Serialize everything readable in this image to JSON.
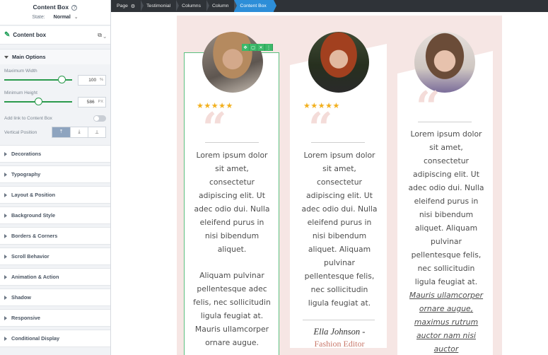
{
  "sidebar": {
    "title": "Content Box",
    "help_icon": "?",
    "state_label": "State:",
    "state_value": "Normal",
    "block_label": "Content box",
    "main_options": {
      "header": "Main Options",
      "max_width_label": "Maximum Width",
      "max_width_value": "100",
      "max_width_unit": "%",
      "max_width_slider": 0.85,
      "min_height_label": "Minimum Height",
      "min_height_value": "586",
      "min_height_unit": "PX",
      "min_height_slider": 0.5,
      "link_label": "Add link to Content Box",
      "vpos_label": "Vertical Position",
      "vpos_options": [
        "⤒",
        "⤓",
        "⊥"
      ]
    },
    "sections": [
      "Decorations",
      "Typography",
      "Layout & Position",
      "Background Style",
      "Borders & Corners",
      "Scroll Behavior",
      "Animation & Action",
      "Shadow",
      "Responsive",
      "Conditional Display"
    ]
  },
  "breadcrumb": [
    "Page",
    "Testimonial",
    "Columns",
    "Column",
    "Content Box"
  ],
  "canvas": {
    "toolbar": [
      "✥",
      "▢",
      "🗑",
      "⋮"
    ],
    "cards": [
      {
        "stars": "★★★★★",
        "quote": "“",
        "text": "Lorem ipsum dolor sit amet, consectetur adipiscing elit. Ut adec odio dui. Nulla eleifend purus in nisi bibendum aliquet.",
        "text2": "Aliquam pulvinar pellentesque adec felis, nec sollicitudin ligula feugiat at. Mauris ullamcorper ornare augue."
      },
      {
        "stars": "★★★★★",
        "quote": "“",
        "text": "Lorem ipsum dolor sit amet, consectetur adipiscing elit. Ut adec odio dui. Nulla eleifend purus in nisi bibendum aliquet. Aliquam pulvinar pellentesque felis, nec sollicitudin ligula feugiat at.",
        "name": "Ella Johnson -",
        "role": "Fashion Editor"
      },
      {
        "quote": "“",
        "text": "Lorem ipsum dolor sit amet, consectetur adipiscing elit. Ut adec odio dui. Nulla eleifend purus in nisi bibendum aliquet. Aliquam pulvinar pellentesque felis, nec sollicitudin ligula feugiat at.",
        "italic": "Mauris ullamcorper ornare augue, maximus rutrum auctor nam nisi auctor"
      }
    ]
  },
  "colors": {
    "accent_green": "#2a9a4c",
    "breadcrumb_active": "#2d8ed8",
    "stage_bg": "#f6e6e4",
    "star": "#f2b01e"
  }
}
